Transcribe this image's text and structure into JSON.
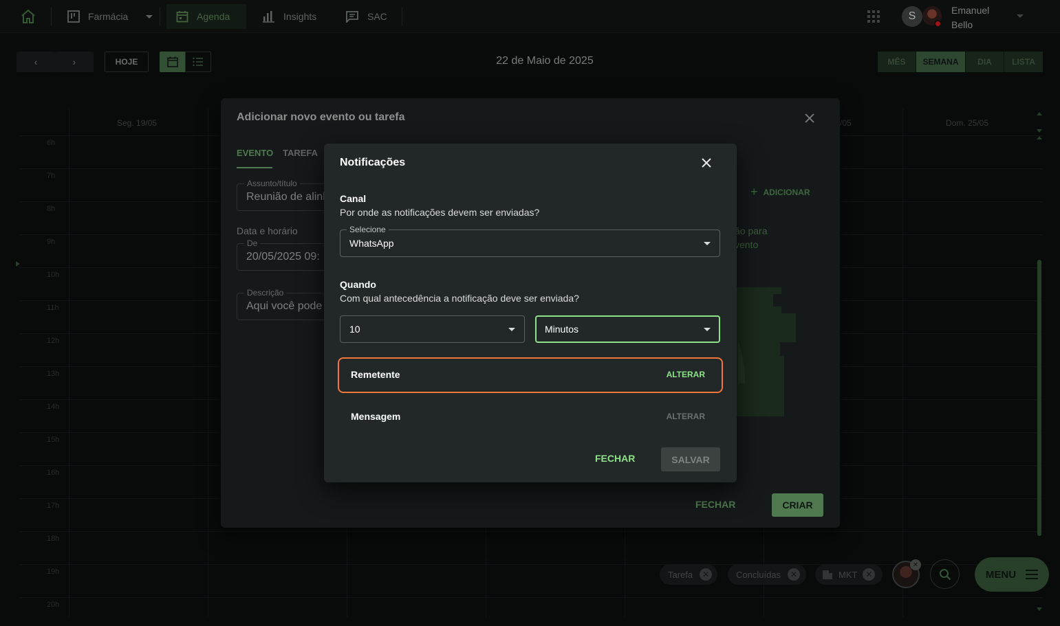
{
  "nav": {
    "home_icon": "home-icon",
    "items": [
      {
        "label": "Farmácia",
        "icon": "kanban-board-icon"
      },
      {
        "label": "Agenda",
        "icon": "calendar-icon"
      },
      {
        "label": "Insights",
        "icon": "bar-chart-icon"
      },
      {
        "label": "SAC",
        "icon": "message-icon"
      }
    ],
    "apps_icon": "apps-grid-icon",
    "avatar_initial": "S",
    "user_first": "Emanuel",
    "user_last": "Bello"
  },
  "toolbar": {
    "today_label": "HOJE",
    "date_title": "22 de Maio de 2025",
    "views": [
      "MÊS",
      "SEMANA",
      "DIA",
      "LISTA"
    ],
    "active_view": "SEMANA"
  },
  "calendar": {
    "days": [
      "Seg. 19/05",
      "/05",
      "Dom. 25/05"
    ],
    "hours": [
      "6h",
      "7h",
      "8h",
      "9h",
      "10h",
      "11h",
      "12h",
      "13h",
      "14h",
      "15h",
      "16h",
      "17h",
      "18h",
      "19h",
      "20h"
    ]
  },
  "filters": {
    "chips": [
      "Tarefa",
      "Concluídas",
      "MKT"
    ],
    "menu_label": "MENU"
  },
  "event_modal": {
    "title": "Adicionar novo evento ou tarefa",
    "tabs": [
      "EVENTO",
      "TAREFA"
    ],
    "subject_label": "Assunto/título",
    "subject_value": "Reunião de alinh",
    "datetime_heading": "Data e horário",
    "from_label": "De",
    "from_value": "20/05/2025 09:",
    "description_label": "Descrição",
    "description_value": "Aqui você pode",
    "add_label": "ADICIONAR",
    "hint_line1": "ão para",
    "hint_line2": "vento",
    "close_label": "FECHAR",
    "create_label": "CRIAR"
  },
  "notifications": {
    "title": "Notificações",
    "channel": {
      "label": "Canal",
      "description": "Por onde as notificações devem ser enviadas?",
      "select_label": "Selecione",
      "value": "WhatsApp"
    },
    "when": {
      "label": "Quando",
      "description": "Com qual antecedência a notificação deve ser enviada?",
      "amount": "10",
      "unit": "Minutos"
    },
    "sender": {
      "label": "Remetente",
      "action": "ALTERAR"
    },
    "message": {
      "label": "Mensagem",
      "action": "ALTERAR"
    },
    "close_label": "FECHAR",
    "save_label": "SALVAR"
  },
  "colors": {
    "accent_green": "#8ee28a",
    "highlight_orange": "#f2753b",
    "button_green": "#4f7a4f"
  }
}
